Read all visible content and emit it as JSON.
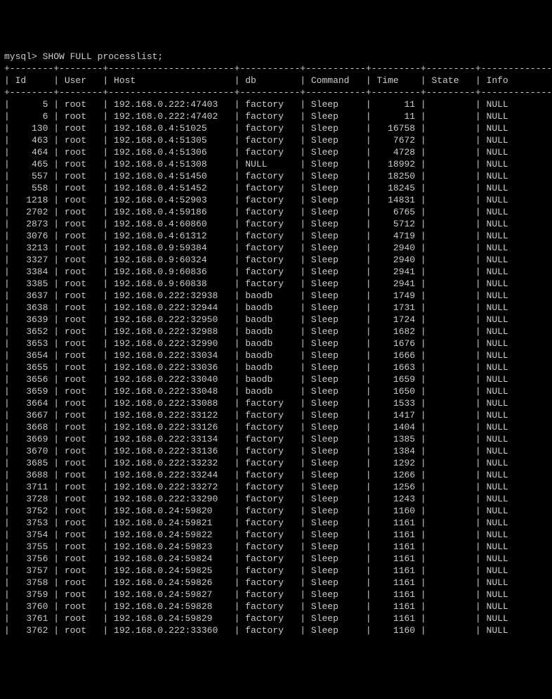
{
  "prompt": "mysql> SHOW FULL processlist;",
  "columns": [
    "Id",
    "User",
    "Host",
    "db",
    "Command",
    "Time",
    "State",
    "Info"
  ],
  "col_widths": {
    "id": 6,
    "user": 6,
    "host": 21,
    "db": 9,
    "command": 9,
    "time": 7,
    "state": 7,
    "info": 6
  },
  "rows": [
    {
      "id": "5",
      "user": "root",
      "host": "192.168.0.222:47403",
      "db": "factory",
      "command": "Sleep",
      "time": "11",
      "state": "",
      "info": "NULL"
    },
    {
      "id": "6",
      "user": "root",
      "host": "192.168.0.222:47402",
      "db": "factory",
      "command": "Sleep",
      "time": "11",
      "state": "",
      "info": "NULL"
    },
    {
      "id": "130",
      "user": "root",
      "host": "192.168.0.4:51025",
      "db": "factory",
      "command": "Sleep",
      "time": "16758",
      "state": "",
      "info": "NULL"
    },
    {
      "id": "463",
      "user": "root",
      "host": "192.168.0.4:51305",
      "db": "factory",
      "command": "Sleep",
      "time": "7672",
      "state": "",
      "info": "NULL"
    },
    {
      "id": "464",
      "user": "root",
      "host": "192.168.0.4:51306",
      "db": "factory",
      "command": "Sleep",
      "time": "4728",
      "state": "",
      "info": "NULL"
    },
    {
      "id": "465",
      "user": "root",
      "host": "192.168.0.4:51308",
      "db": "NULL",
      "command": "Sleep",
      "time": "18992",
      "state": "",
      "info": "NULL"
    },
    {
      "id": "557",
      "user": "root",
      "host": "192.168.0.4:51450",
      "db": "factory",
      "command": "Sleep",
      "time": "18250",
      "state": "",
      "info": "NULL"
    },
    {
      "id": "558",
      "user": "root",
      "host": "192.168.0.4:51452",
      "db": "factory",
      "command": "Sleep",
      "time": "18245",
      "state": "",
      "info": "NULL"
    },
    {
      "id": "1218",
      "user": "root",
      "host": "192.168.0.4:52903",
      "db": "factory",
      "command": "Sleep",
      "time": "14831",
      "state": "",
      "info": "NULL"
    },
    {
      "id": "2702",
      "user": "root",
      "host": "192.168.0.4:59186",
      "db": "factory",
      "command": "Sleep",
      "time": "6765",
      "state": "",
      "info": "NULL"
    },
    {
      "id": "2873",
      "user": "root",
      "host": "192.168.0.4:60860",
      "db": "factory",
      "command": "Sleep",
      "time": "5712",
      "state": "",
      "info": "NULL"
    },
    {
      "id": "3076",
      "user": "root",
      "host": "192.168.0.4:61312",
      "db": "factory",
      "command": "Sleep",
      "time": "4719",
      "state": "",
      "info": "NULL"
    },
    {
      "id": "3213",
      "user": "root",
      "host": "192.168.0.9:59384",
      "db": "factory",
      "command": "Sleep",
      "time": "2940",
      "state": "",
      "info": "NULL"
    },
    {
      "id": "3327",
      "user": "root",
      "host": "192.168.0.9:60324",
      "db": "factory",
      "command": "Sleep",
      "time": "2940",
      "state": "",
      "info": "NULL"
    },
    {
      "id": "3384",
      "user": "root",
      "host": "192.168.0.9:60836",
      "db": "factory",
      "command": "Sleep",
      "time": "2941",
      "state": "",
      "info": "NULL"
    },
    {
      "id": "3385",
      "user": "root",
      "host": "192.168.0.9:60838",
      "db": "factory",
      "command": "Sleep",
      "time": "2941",
      "state": "",
      "info": "NULL"
    },
    {
      "id": "3637",
      "user": "root",
      "host": "192.168.0.222:32938",
      "db": "baodb",
      "command": "Sleep",
      "time": "1749",
      "state": "",
      "info": "NULL"
    },
    {
      "id": "3638",
      "user": "root",
      "host": "192.168.0.222:32944",
      "db": "baodb",
      "command": "Sleep",
      "time": "1731",
      "state": "",
      "info": "NULL"
    },
    {
      "id": "3639",
      "user": "root",
      "host": "192.168.0.222:32950",
      "db": "baodb",
      "command": "Sleep",
      "time": "1724",
      "state": "",
      "info": "NULL"
    },
    {
      "id": "3652",
      "user": "root",
      "host": "192.168.0.222:32988",
      "db": "baodb",
      "command": "Sleep",
      "time": "1682",
      "state": "",
      "info": "NULL"
    },
    {
      "id": "3653",
      "user": "root",
      "host": "192.168.0.222:32990",
      "db": "baodb",
      "command": "Sleep",
      "time": "1676",
      "state": "",
      "info": "NULL"
    },
    {
      "id": "3654",
      "user": "root",
      "host": "192.168.0.222:33034",
      "db": "baodb",
      "command": "Sleep",
      "time": "1666",
      "state": "",
      "info": "NULL"
    },
    {
      "id": "3655",
      "user": "root",
      "host": "192.168.0.222:33036",
      "db": "baodb",
      "command": "Sleep",
      "time": "1663",
      "state": "",
      "info": "NULL"
    },
    {
      "id": "3656",
      "user": "root",
      "host": "192.168.0.222:33040",
      "db": "baodb",
      "command": "Sleep",
      "time": "1659",
      "state": "",
      "info": "NULL"
    },
    {
      "id": "3659",
      "user": "root",
      "host": "192.168.0.222:33048",
      "db": "baodb",
      "command": "Sleep",
      "time": "1650",
      "state": "",
      "info": "NULL"
    },
    {
      "id": "3664",
      "user": "root",
      "host": "192.168.0.222:33088",
      "db": "factory",
      "command": "Sleep",
      "time": "1533",
      "state": "",
      "info": "NULL"
    },
    {
      "id": "3667",
      "user": "root",
      "host": "192.168.0.222:33122",
      "db": "factory",
      "command": "Sleep",
      "time": "1417",
      "state": "",
      "info": "NULL"
    },
    {
      "id": "3668",
      "user": "root",
      "host": "192.168.0.222:33126",
      "db": "factory",
      "command": "Sleep",
      "time": "1404",
      "state": "",
      "info": "NULL"
    },
    {
      "id": "3669",
      "user": "root",
      "host": "192.168.0.222:33134",
      "db": "factory",
      "command": "Sleep",
      "time": "1385",
      "state": "",
      "info": "NULL"
    },
    {
      "id": "3670",
      "user": "root",
      "host": "192.168.0.222:33136",
      "db": "factory",
      "command": "Sleep",
      "time": "1384",
      "state": "",
      "info": "NULL"
    },
    {
      "id": "3685",
      "user": "root",
      "host": "192.168.0.222:33232",
      "db": "factory",
      "command": "Sleep",
      "time": "1292",
      "state": "",
      "info": "NULL"
    },
    {
      "id": "3688",
      "user": "root",
      "host": "192.168.0.222:33244",
      "db": "factory",
      "command": "Sleep",
      "time": "1266",
      "state": "",
      "info": "NULL"
    },
    {
      "id": "3711",
      "user": "root",
      "host": "192.168.0.222:33272",
      "db": "factory",
      "command": "Sleep",
      "time": "1256",
      "state": "",
      "info": "NULL"
    },
    {
      "id": "3728",
      "user": "root",
      "host": "192.168.0.222:33290",
      "db": "factory",
      "command": "Sleep",
      "time": "1243",
      "state": "",
      "info": "NULL"
    },
    {
      "id": "3752",
      "user": "root",
      "host": "192.168.0.24:59820",
      "db": "factory",
      "command": "Sleep",
      "time": "1160",
      "state": "",
      "info": "NULL"
    },
    {
      "id": "3753",
      "user": "root",
      "host": "192.168.0.24:59821",
      "db": "factory",
      "command": "Sleep",
      "time": "1161",
      "state": "",
      "info": "NULL"
    },
    {
      "id": "3754",
      "user": "root",
      "host": "192.168.0.24:59822",
      "db": "factory",
      "command": "Sleep",
      "time": "1161",
      "state": "",
      "info": "NULL"
    },
    {
      "id": "3755",
      "user": "root",
      "host": "192.168.0.24:59823",
      "db": "factory",
      "command": "Sleep",
      "time": "1161",
      "state": "",
      "info": "NULL"
    },
    {
      "id": "3756",
      "user": "root",
      "host": "192.168.0.24:59824",
      "db": "factory",
      "command": "Sleep",
      "time": "1161",
      "state": "",
      "info": "NULL"
    },
    {
      "id": "3757",
      "user": "root",
      "host": "192.168.0.24:59825",
      "db": "factory",
      "command": "Sleep",
      "time": "1161",
      "state": "",
      "info": "NULL"
    },
    {
      "id": "3758",
      "user": "root",
      "host": "192.168.0.24:59826",
      "db": "factory",
      "command": "Sleep",
      "time": "1161",
      "state": "",
      "info": "NULL"
    },
    {
      "id": "3759",
      "user": "root",
      "host": "192.168.0.24:59827",
      "db": "factory",
      "command": "Sleep",
      "time": "1161",
      "state": "",
      "info": "NULL"
    },
    {
      "id": "3760",
      "user": "root",
      "host": "192.168.0.24:59828",
      "db": "factory",
      "command": "Sleep",
      "time": "1161",
      "state": "",
      "info": "NULL"
    },
    {
      "id": "3761",
      "user": "root",
      "host": "192.168.0.24:59829",
      "db": "factory",
      "command": "Sleep",
      "time": "1161",
      "state": "",
      "info": "NULL"
    },
    {
      "id": "3762",
      "user": "root",
      "host": "192.168.0.222:33360",
      "db": "factory",
      "command": "Sleep",
      "time": "1160",
      "state": "",
      "info": "NULL"
    }
  ]
}
